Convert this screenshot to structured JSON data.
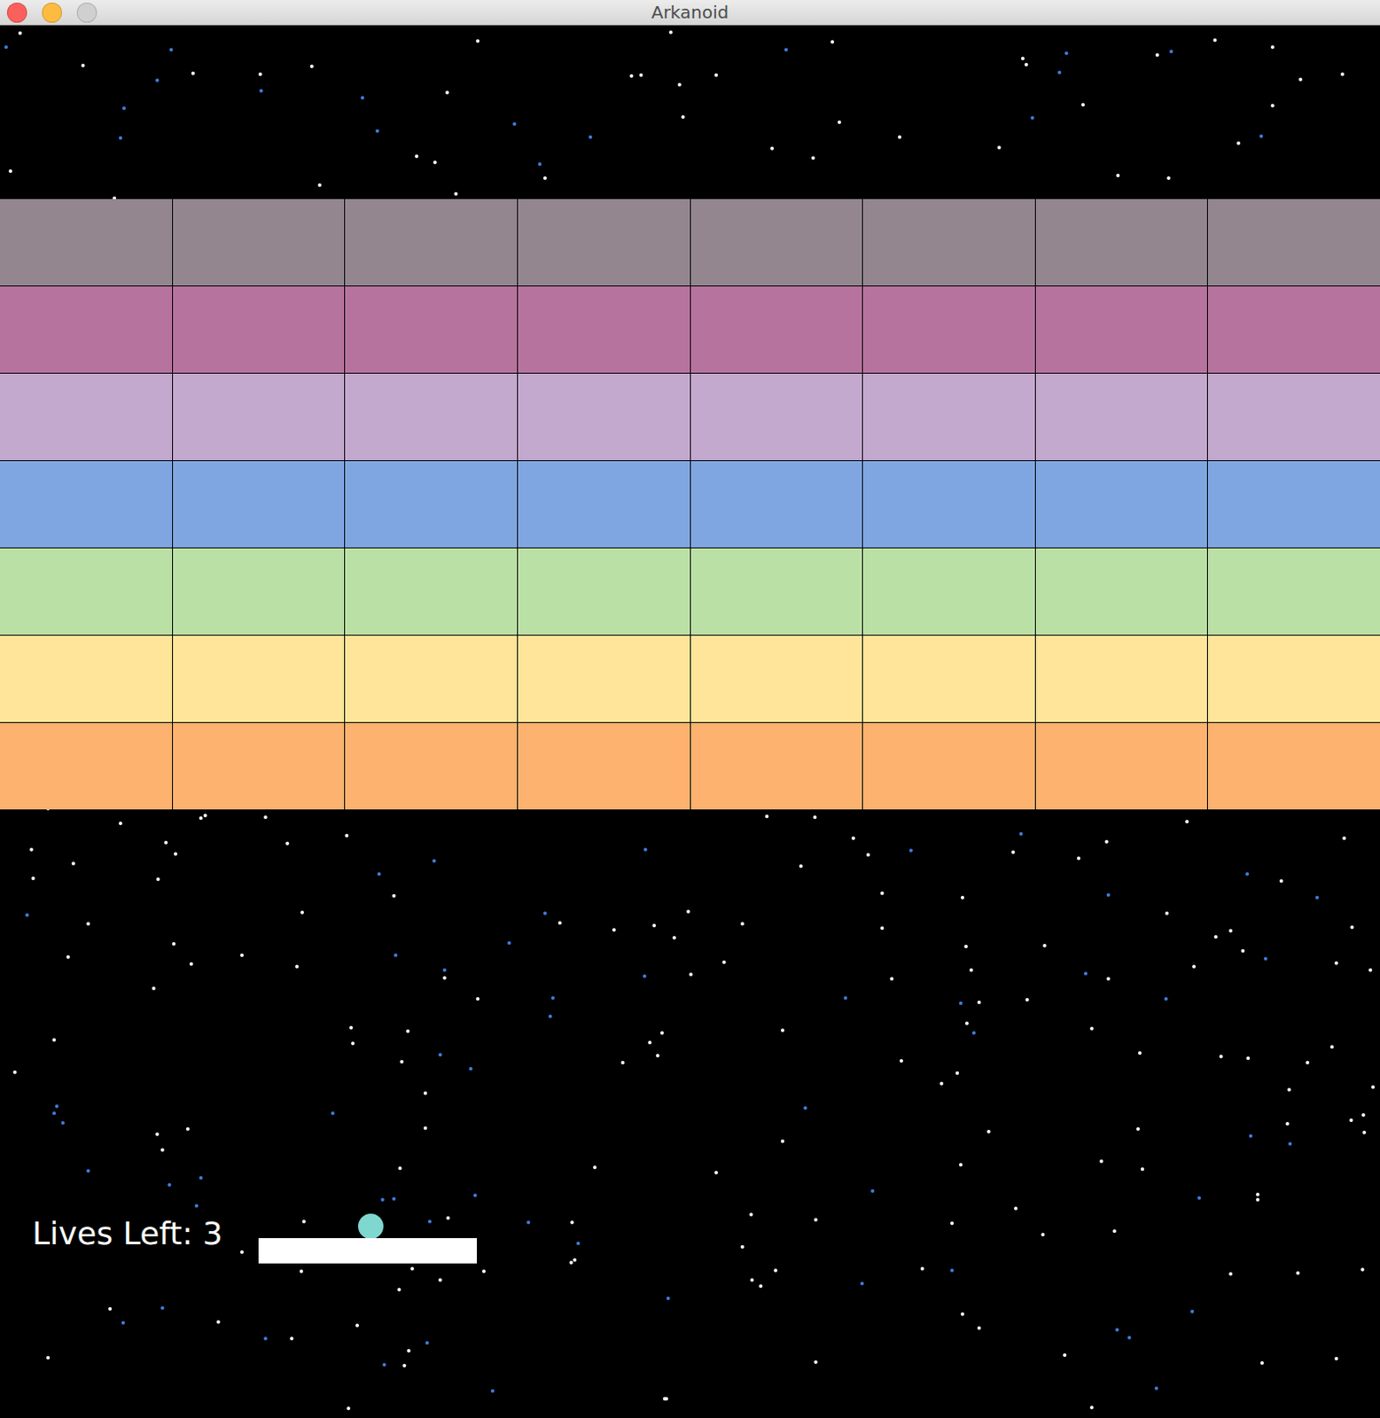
{
  "window": {
    "title": "Arkanoid",
    "buttons": [
      {
        "name": "close",
        "color": "#fc605c",
        "disabled": false
      },
      {
        "name": "minimize",
        "color": "#fdbc40",
        "disabled": false
      },
      {
        "name": "zoom",
        "color": "#d0d0d0",
        "disabled": true
      }
    ]
  },
  "bricks": {
    "rows": [
      {
        "color": "#93868f",
        "bricks": [
          {
            "intact": true
          },
          {
            "intact": true
          },
          {
            "intact": true
          },
          {
            "intact": true
          },
          {
            "intact": true
          },
          {
            "intact": true
          },
          {
            "intact": true
          },
          {
            "intact": true
          }
        ]
      },
      {
        "color": "#b6739d",
        "bricks": [
          {
            "intact": true
          },
          {
            "intact": true
          },
          {
            "intact": true
          },
          {
            "intact": true
          },
          {
            "intact": true
          },
          {
            "intact": true
          },
          {
            "intact": true
          },
          {
            "intact": true
          }
        ]
      },
      {
        "color": "#c3a9ce",
        "bricks": [
          {
            "intact": true
          },
          {
            "intact": true
          },
          {
            "intact": true
          },
          {
            "intact": true
          },
          {
            "intact": true
          },
          {
            "intact": true
          },
          {
            "intact": true
          },
          {
            "intact": true
          }
        ]
      },
      {
        "color": "#7fa6e0",
        "bricks": [
          {
            "intact": true
          },
          {
            "intact": true
          },
          {
            "intact": true
          },
          {
            "intact": true
          },
          {
            "intact": true
          },
          {
            "intact": true
          },
          {
            "intact": true
          },
          {
            "intact": true
          }
        ]
      },
      {
        "color": "#bbe0a5",
        "bricks": [
          {
            "intact": true
          },
          {
            "intact": true
          },
          {
            "intact": true
          },
          {
            "intact": true
          },
          {
            "intact": true
          },
          {
            "intact": true
          },
          {
            "intact": true
          },
          {
            "intact": true
          }
        ]
      },
      {
        "color": "#fee59a",
        "bricks": [
          {
            "intact": true
          },
          {
            "intact": true
          },
          {
            "intact": true
          },
          {
            "intact": true
          },
          {
            "intact": true
          },
          {
            "intact": true
          },
          {
            "intact": true
          },
          {
            "intact": true
          }
        ]
      },
      {
        "color": "#feb26f",
        "bricks": [
          {
            "intact": true
          },
          {
            "intact": true
          },
          {
            "intact": true
          },
          {
            "intact": true
          },
          {
            "intact": true
          },
          {
            "intact": true
          },
          {
            "intact": true
          },
          {
            "intact": true
          }
        ]
      }
    ]
  },
  "hud": {
    "lives": "Lives Left: 3"
  },
  "paddle": {
    "color": "#ffffff"
  },
  "ball": {
    "color": "#7fd8d0"
  }
}
